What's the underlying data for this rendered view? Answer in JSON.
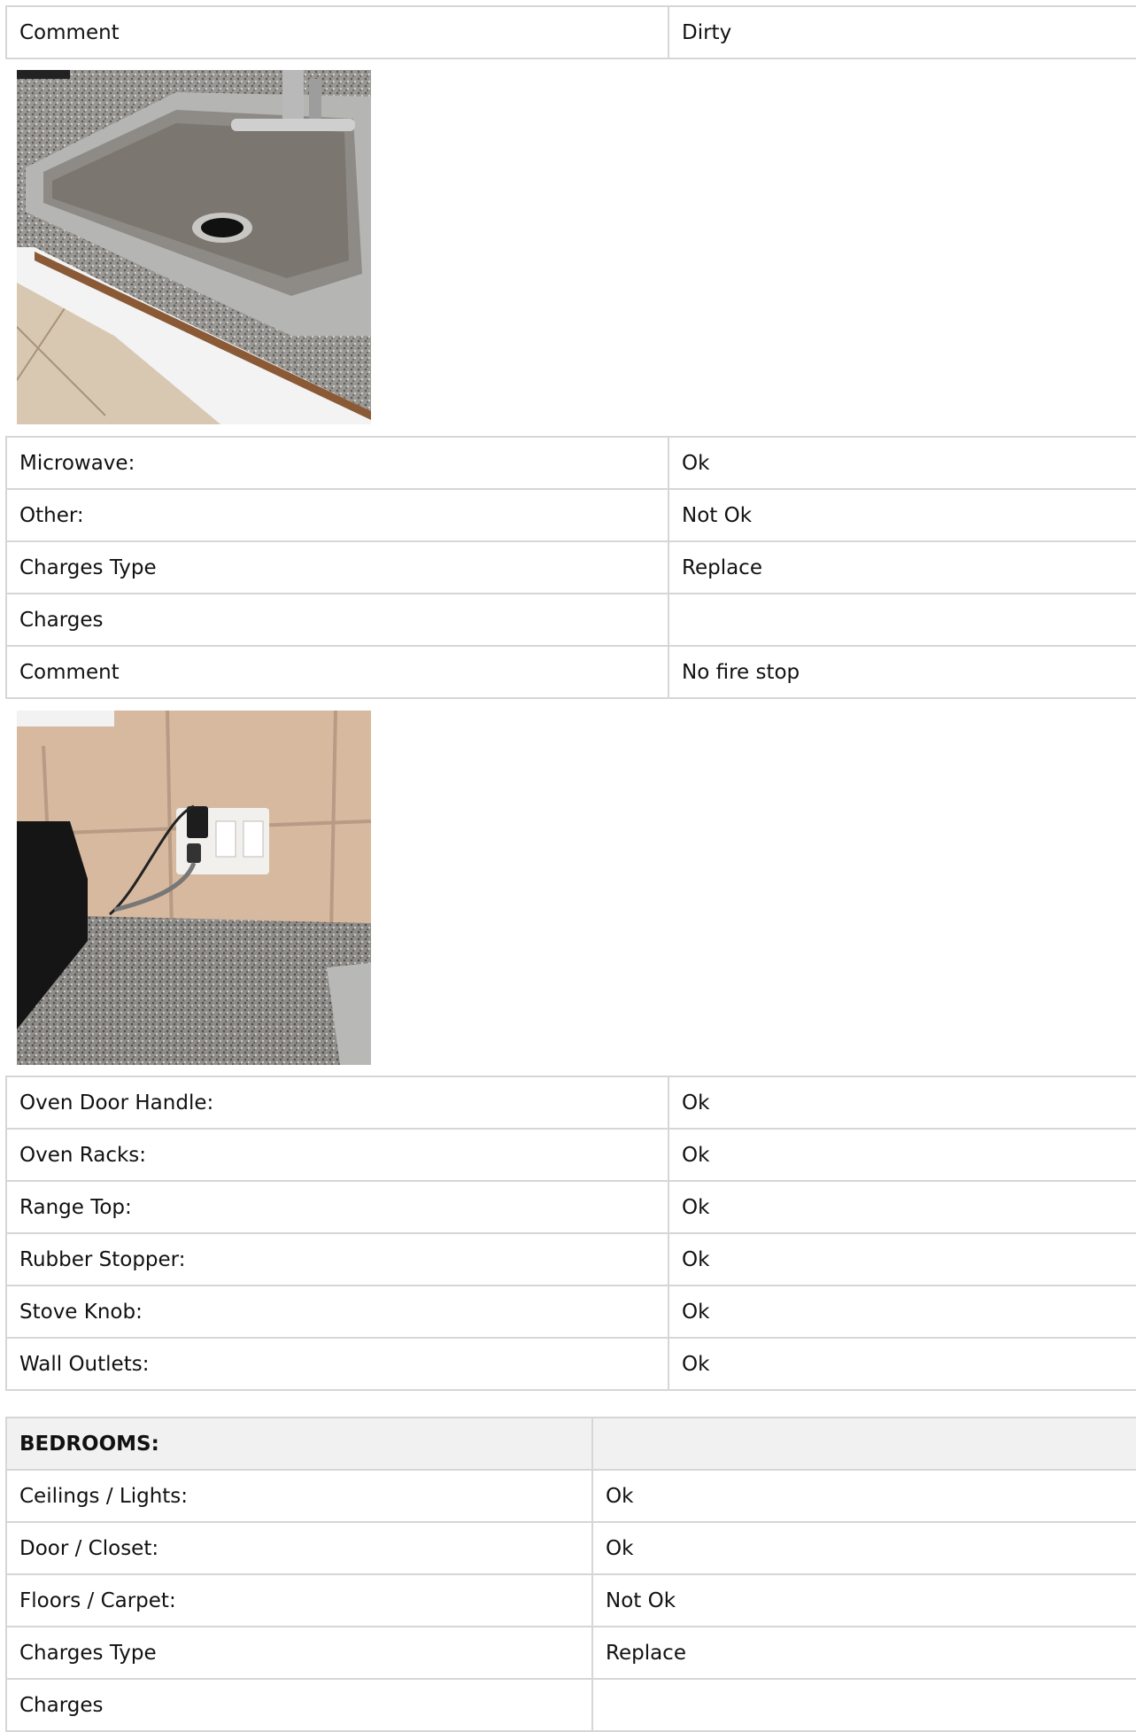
{
  "kitchen_top": [
    {
      "label": "Comment",
      "value": "Dirty"
    }
  ],
  "photo_sink": {
    "icon": "sink-photo"
  },
  "kitchen_mid": [
    {
      "label": "Microwave:",
      "value": "Ok"
    },
    {
      "label": "Other:",
      "value": "Not Ok"
    },
    {
      "label": "Charges Type",
      "value": "Replace"
    },
    {
      "label": "Charges",
      "value": ""
    },
    {
      "label": "Comment",
      "value": "No fire stop"
    }
  ],
  "photo_outlet": {
    "icon": "wall-outlet-photo"
  },
  "kitchen_bottom": [
    {
      "label": "Oven Door Handle:",
      "value": "Ok"
    },
    {
      "label": "Oven Racks:",
      "value": "Ok"
    },
    {
      "label": "Range Top:",
      "value": "Ok"
    },
    {
      "label": "Rubber Stopper:",
      "value": "Ok"
    },
    {
      "label": "Stove Knob:",
      "value": "Ok"
    },
    {
      "label": "Wall Outlets:",
      "value": "Ok"
    }
  ],
  "bedrooms": {
    "header": "BEDROOMS:",
    "header_value": "",
    "rows": [
      {
        "label": "Ceilings / Lights:",
        "value": "Ok"
      },
      {
        "label": "Door / Closet:",
        "value": "Ok"
      },
      {
        "label": "Floors / Carpet:",
        "value": "Not Ok"
      },
      {
        "label": "Charges Type",
        "value": "Replace"
      },
      {
        "label": "Charges",
        "value": ""
      }
    ]
  }
}
